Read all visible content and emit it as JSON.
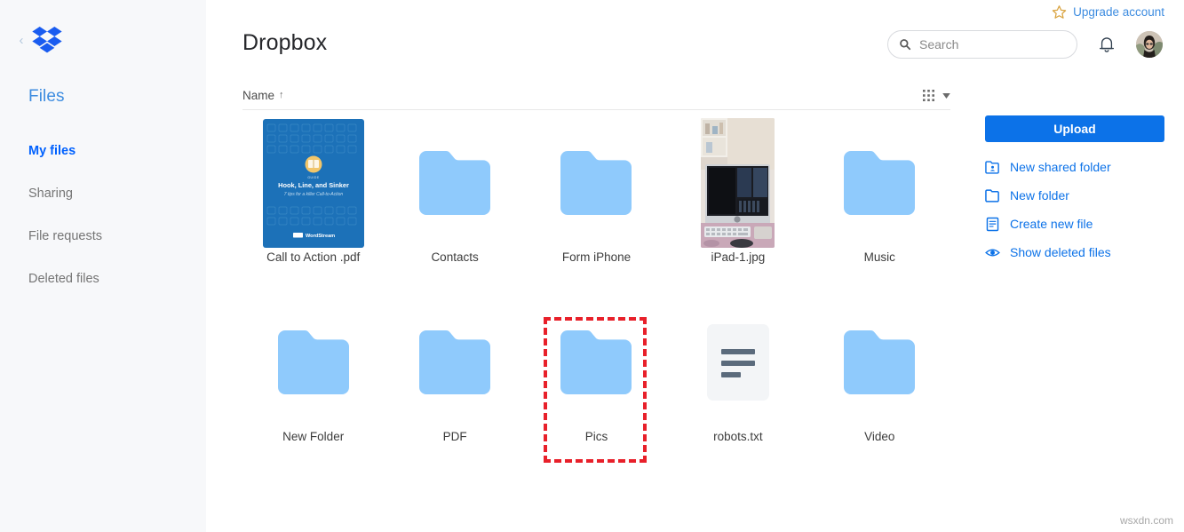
{
  "sidebar": {
    "logo_name": "dropbox-logo",
    "collapse_glyph": "‹",
    "files_heading": "Files",
    "items": [
      {
        "label": "My files",
        "active": true
      },
      {
        "label": "Sharing",
        "active": false
      },
      {
        "label": "File requests",
        "active": false
      },
      {
        "label": "Deleted files",
        "active": false
      }
    ]
  },
  "header": {
    "upgrade_label": "Upgrade account",
    "title": "Dropbox",
    "search": {
      "placeholder": "Search",
      "value": ""
    }
  },
  "list_header": {
    "name_label": "Name",
    "sort_arrow": "↑",
    "sort_direction": "ascending",
    "view_mode": "grid"
  },
  "files": [
    [
      {
        "label": "Call to Action .pdf",
        "type": "pdf-thumbnail",
        "thumb_title": "Hook, Line, and Sinker",
        "thumb_subtitle": "7 tips for a killer Call-to-Action",
        "thumb_kicker": "GUIDE",
        "thumb_brand": "WordStream",
        "selected": false
      },
      {
        "label": "Contacts",
        "type": "folder",
        "selected": false
      },
      {
        "label": "Form iPhone",
        "type": "folder",
        "selected": false
      },
      {
        "label": "iPad-1.jpg",
        "type": "image-thumbnail",
        "selected": false
      },
      {
        "label": "Music",
        "type": "folder",
        "selected": false
      }
    ],
    [
      {
        "label": "New Folder",
        "type": "folder",
        "selected": false
      },
      {
        "label": "PDF",
        "type": "folder",
        "selected": false
      },
      {
        "label": "Pics",
        "type": "folder",
        "selected": true
      },
      {
        "label": "robots.txt",
        "type": "text-file",
        "selected": false
      },
      {
        "label": "Video",
        "type": "folder",
        "selected": false
      }
    ]
  ],
  "actions": {
    "upload_label": "Upload",
    "items": [
      {
        "label": "New shared folder",
        "icon": "shared-folder-icon"
      },
      {
        "label": "New folder",
        "icon": "folder-icon"
      },
      {
        "label": "Create new file",
        "icon": "document-icon"
      },
      {
        "label": "Show deleted files",
        "icon": "eye-icon"
      }
    ]
  },
  "colors": {
    "brand_blue": "#0061fe",
    "button_blue": "#0c72e8",
    "link_blue": "#3d8ce0",
    "folder_blue": "#8fcafc",
    "sidebar_bg": "#f7f8fa",
    "highlight_red": "#e8202a"
  },
  "watermark": "wsxdn.com"
}
